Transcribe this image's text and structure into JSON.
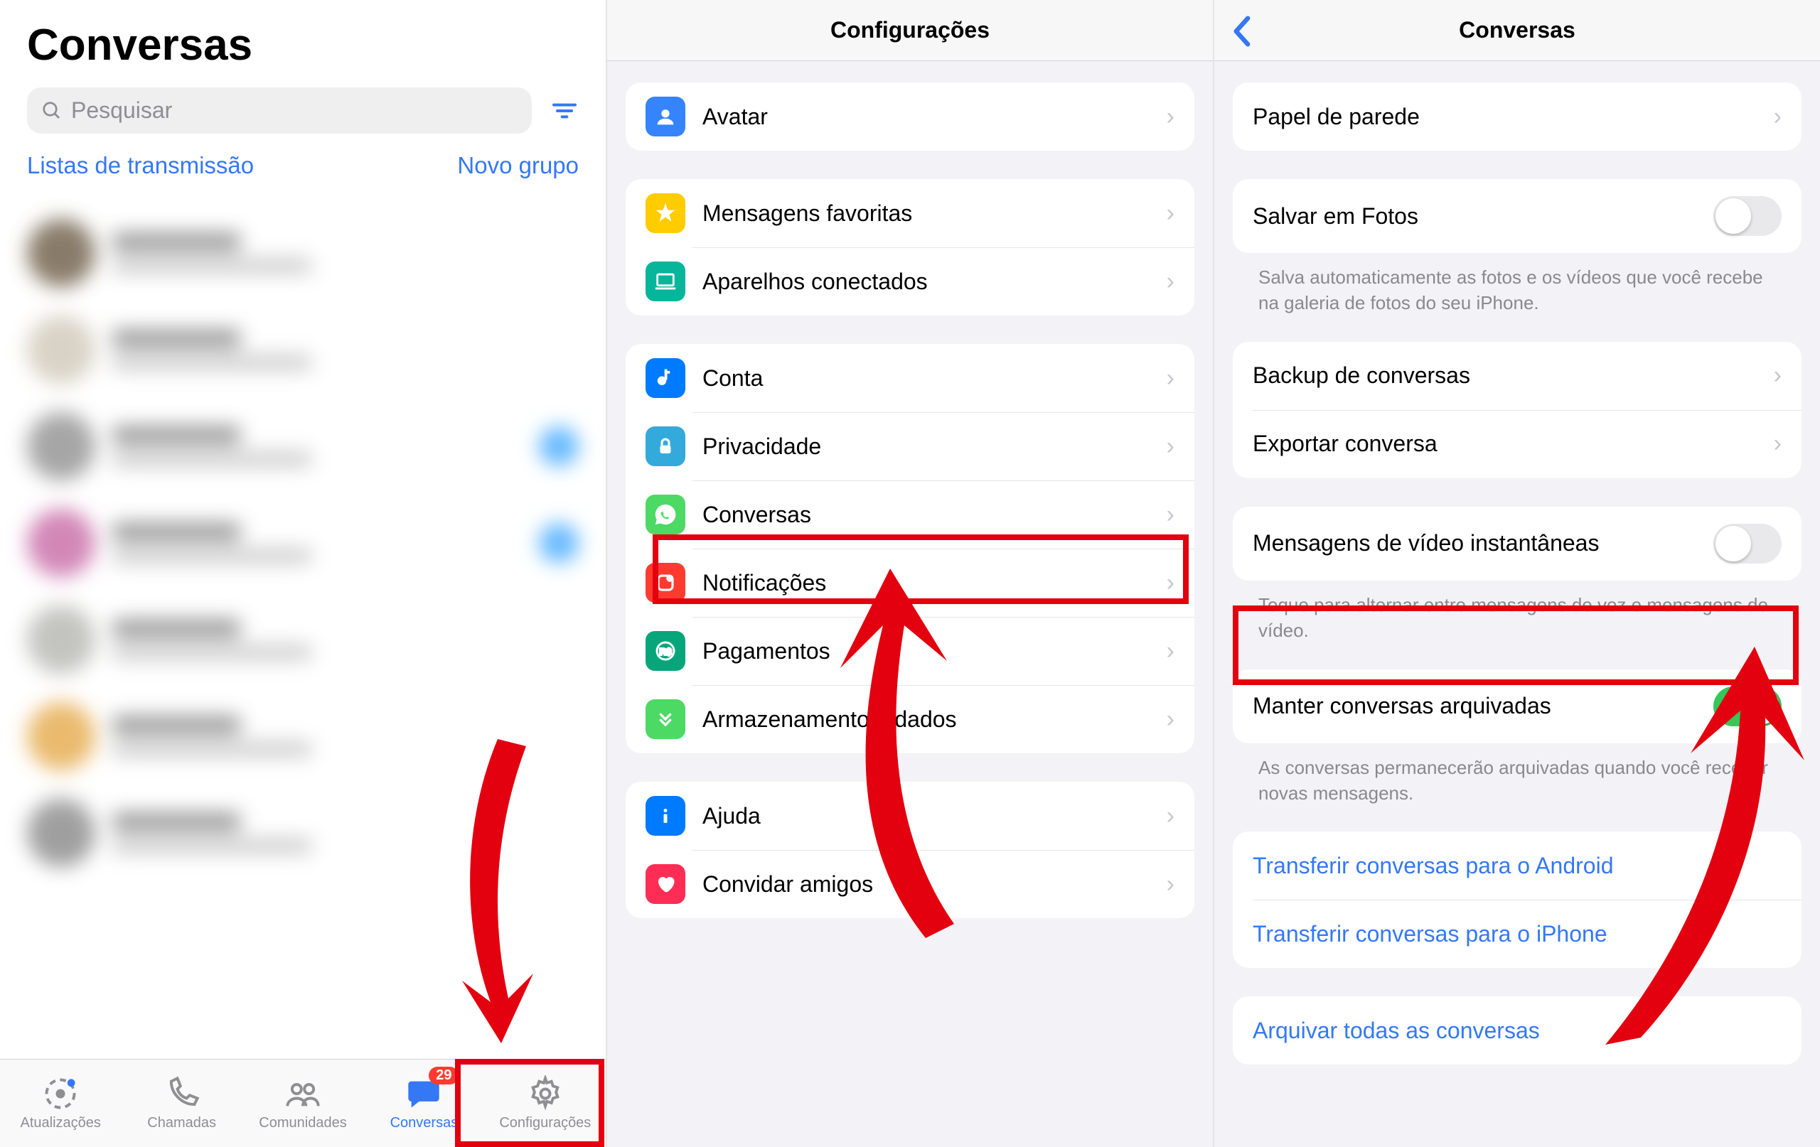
{
  "panel1": {
    "title": "Conversas",
    "search_placeholder": "Pesquisar",
    "broadcast_link": "Listas de transmissão",
    "new_group_link": "Novo grupo",
    "tabs": [
      {
        "label": "Atualizações"
      },
      {
        "label": "Chamadas"
      },
      {
        "label": "Comunidades"
      },
      {
        "label": "Conversas",
        "badge": "29"
      },
      {
        "label": "Configurações"
      }
    ]
  },
  "panel2": {
    "header": "Configurações",
    "group1": [
      {
        "label": "Avatar",
        "icon_color": "#3584fc"
      }
    ],
    "group2": [
      {
        "label": "Mensagens favoritas",
        "icon_color": "#ffcc00"
      },
      {
        "label": "Aparelhos conectados",
        "icon_color": "#06b59a"
      }
    ],
    "group3": [
      {
        "label": "Conta",
        "icon_color": "#007aff"
      },
      {
        "label": "Privacidade",
        "icon_color": "#34aadc"
      },
      {
        "label": "Conversas",
        "icon_color": "#4cd964"
      },
      {
        "label": "Notificações",
        "icon_color": "#ff3b30"
      },
      {
        "label": "Pagamentos",
        "icon_color": "#06a67a"
      },
      {
        "label": "Armazenamento e dados",
        "icon_color": "#4cd964"
      }
    ],
    "group4": [
      {
        "label": "Ajuda",
        "icon_color": "#007aff"
      },
      {
        "label": "Convidar amigos",
        "icon_color": "#ff2d55"
      }
    ]
  },
  "panel3": {
    "header": "Conversas",
    "wallpaper": "Papel de parede",
    "save_photos": "Salvar em Fotos",
    "save_photos_note": "Salva automaticamente as fotos e os vídeos que você recebe na galeria de fotos do seu iPhone.",
    "backup": "Backup de conversas",
    "export": "Exportar conversa",
    "instant_video": "Mensagens de vídeo instantâneas",
    "instant_video_note": "Toque para alternar entre mensagens de voz e mensagens de vídeo.",
    "keep_archived": "Manter conversas arquivadas",
    "keep_archived_note": "As conversas permanecerão arquivadas quando você receber novas mensagens.",
    "transfer_android": "Transferir conversas para o Android",
    "transfer_iphone": "Transferir conversas para o iPhone",
    "archive_all": "Arquivar todas as conversas"
  }
}
